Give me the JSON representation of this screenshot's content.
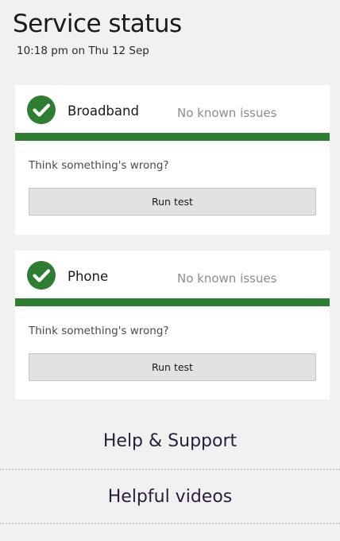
{
  "page": {
    "title": "Service status",
    "timestamp": "10:18 pm on Thu 12 Sep"
  },
  "services": [
    {
      "name": "Broadband",
      "status": "No known issues",
      "status_color": "#2f7d32",
      "icon": "check-circle-icon",
      "prompt": "Think something's wrong?",
      "button_label": "Run test"
    },
    {
      "name": "Phone",
      "status": "No known issues",
      "status_color": "#2f7d32",
      "icon": "check-circle-icon",
      "prompt": "Think something's wrong?",
      "button_label": "Run test"
    }
  ],
  "links": {
    "help": "Help & Support",
    "videos": "Helpful videos"
  },
  "colors": {
    "ok_green": "#2f7d32",
    "link_text": "#2a1e3a",
    "background": "#f1f1f1"
  }
}
